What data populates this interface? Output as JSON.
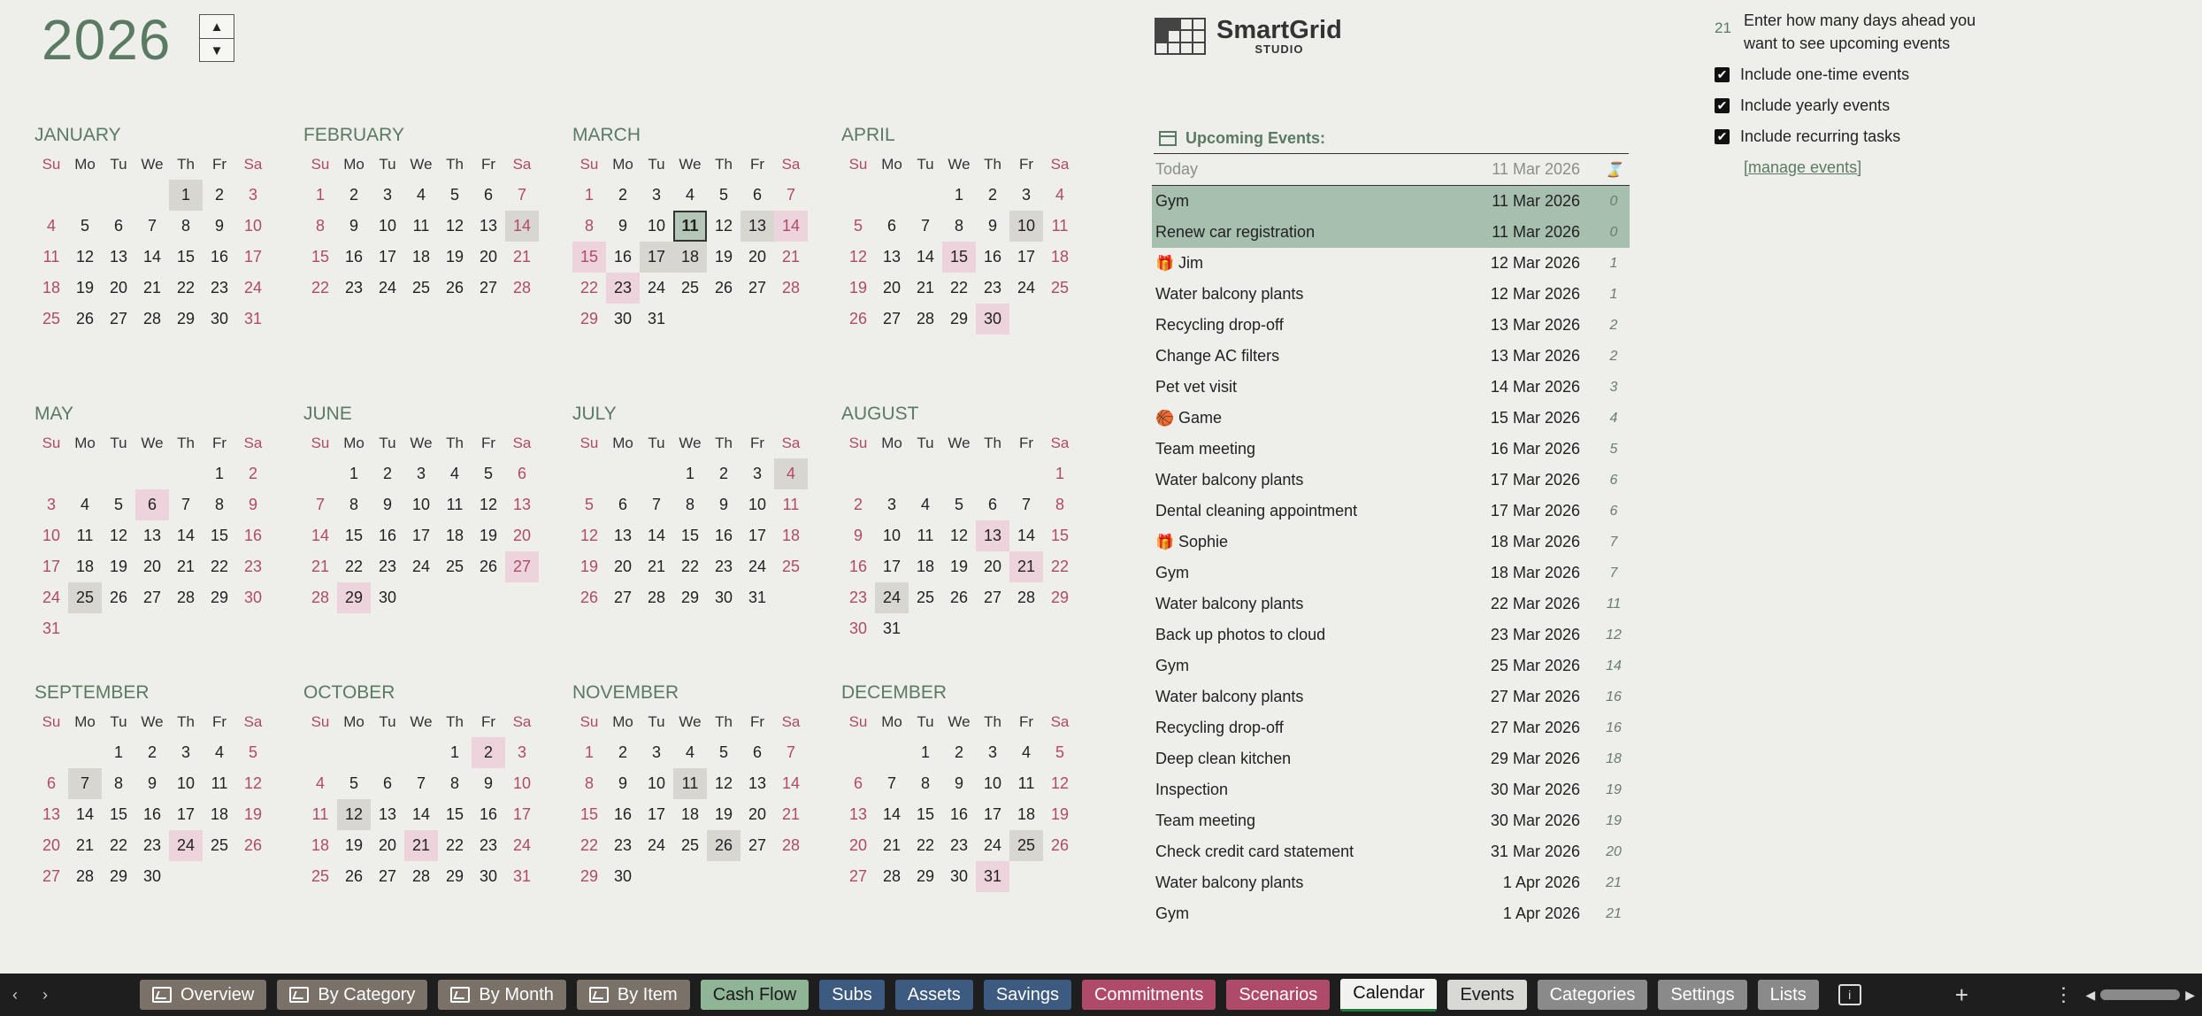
{
  "year": "2026",
  "spinner": {
    "up": "▲",
    "down": "▼"
  },
  "dow": [
    "Su",
    "Mo",
    "Tu",
    "We",
    "Th",
    "Fr",
    "Sa"
  ],
  "months": [
    {
      "name": "JANUARY",
      "start": 4,
      "days": 31,
      "gray": [
        1
      ],
      "pink": []
    },
    {
      "name": "FEBRUARY",
      "start": 0,
      "days": 28,
      "gray": [
        14
      ],
      "pink": []
    },
    {
      "name": "MARCH",
      "start": 0,
      "days": 31,
      "gray": [
        13,
        17,
        18
      ],
      "pink": [
        14,
        15,
        23
      ],
      "today": 11
    },
    {
      "name": "APRIL",
      "start": 3,
      "days": 30,
      "gray": [
        10
      ],
      "pink": [
        15,
        30
      ]
    },
    {
      "name": "MAY",
      "start": 5,
      "days": 31,
      "gray": [
        25
      ],
      "pink": [
        6
      ]
    },
    {
      "name": "JUNE",
      "start": 1,
      "days": 30,
      "gray": [],
      "pink": [
        27,
        29
      ]
    },
    {
      "name": "JULY",
      "start": 3,
      "days": 31,
      "gray": [
        4
      ],
      "pink": []
    },
    {
      "name": "AUGUST",
      "start": 6,
      "days": 31,
      "gray": [
        24
      ],
      "pink": [
        13,
        21
      ]
    },
    {
      "name": "SEPTEMBER",
      "start": 2,
      "days": 30,
      "gray": [
        7
      ],
      "pink": [
        24
      ]
    },
    {
      "name": "OCTOBER",
      "start": 4,
      "days": 31,
      "gray": [
        12
      ],
      "pink": [
        2,
        21
      ]
    },
    {
      "name": "NOVEMBER",
      "start": 0,
      "days": 30,
      "gray": [
        11,
        26
      ],
      "pink": []
    },
    {
      "name": "DECEMBER",
      "start": 2,
      "days": 31,
      "gray": [
        25
      ],
      "pink": [
        31
      ]
    }
  ],
  "logo": {
    "name": "SmartGrid",
    "sub": "STUDIO"
  },
  "settings": {
    "days_ahead": "21",
    "days_desc": "Enter how many days ahead you want to see upcoming events",
    "opt1": "Include one-time events",
    "opt2": "Include yearly events",
    "opt3": "Include recurring tasks",
    "check": "✔",
    "manage": "[manage events]"
  },
  "events": {
    "title": "Upcoming Events:",
    "today_label": "Today",
    "today_date": "11 Mar 2026",
    "hourglass": "⌛",
    "rows": [
      {
        "name": "Gym",
        "date": "11 Mar 2026",
        "days": "0",
        "now": true
      },
      {
        "name": "Renew car registration",
        "date": "11 Mar 2026",
        "days": "0",
        "now": true
      },
      {
        "name": "Jim",
        "date": "12 Mar 2026",
        "days": "1",
        "icon": "gift-icon"
      },
      {
        "name": "Water balcony plants",
        "date": "12 Mar 2026",
        "days": "1"
      },
      {
        "name": "Recycling drop-off",
        "date": "13 Mar 2026",
        "days": "2"
      },
      {
        "name": "Change AC filters",
        "date": "13 Mar 2026",
        "days": "2"
      },
      {
        "name": "Pet vet visit",
        "date": "14 Mar 2026",
        "days": "3"
      },
      {
        "name": "Game",
        "date": "15 Mar 2026",
        "days": "4",
        "icon": "basketball-icon"
      },
      {
        "name": "Team meeting",
        "date": "16 Mar 2026",
        "days": "5"
      },
      {
        "name": "Water balcony plants",
        "date": "17 Mar 2026",
        "days": "6"
      },
      {
        "name": "Dental cleaning appointment",
        "date": "17 Mar 2026",
        "days": "6"
      },
      {
        "name": "Sophie",
        "date": "18 Mar 2026",
        "days": "7",
        "icon": "gift-icon"
      },
      {
        "name": "Gym",
        "date": "18 Mar 2026",
        "days": "7"
      },
      {
        "name": "Water balcony plants",
        "date": "22 Mar 2026",
        "days": "11"
      },
      {
        "name": "Back up photos to cloud",
        "date": "23 Mar 2026",
        "days": "12"
      },
      {
        "name": "Gym",
        "date": "25 Mar 2026",
        "days": "14"
      },
      {
        "name": "Water balcony plants",
        "date": "27 Mar 2026",
        "days": "16"
      },
      {
        "name": "Recycling drop-off",
        "date": "27 Mar 2026",
        "days": "16"
      },
      {
        "name": "Deep clean kitchen",
        "date": "29 Mar 2026",
        "days": "18"
      },
      {
        "name": "Inspection",
        "date": "30 Mar 2026",
        "days": "19"
      },
      {
        "name": "Team meeting",
        "date": "30 Mar 2026",
        "days": "19"
      },
      {
        "name": "Check credit card statement",
        "date": "31 Mar 2026",
        "days": "20"
      },
      {
        "name": "Water balcony plants",
        "date": "1 Apr 2026",
        "days": "21"
      },
      {
        "name": "Gym",
        "date": "1 Apr 2026",
        "days": "21"
      }
    ]
  },
  "icons": {
    "gift-icon": "🎁",
    "basketball-icon": "🏀"
  },
  "tabbar": {
    "prev": "‹",
    "next": "›",
    "plus": "+",
    "more": "⋮",
    "info": "i",
    "scroll_left": "◀",
    "scroll_right": "▶",
    "tabs": [
      {
        "label": "Overview",
        "color": "#7a7268",
        "icon": true
      },
      {
        "label": "By Category",
        "color": "#7a7268",
        "icon": true
      },
      {
        "label": "By Month",
        "color": "#7a7268",
        "icon": true
      },
      {
        "label": "By Item",
        "color": "#7a7268",
        "icon": true
      },
      {
        "label": "Cash Flow",
        "color": "#8fb596",
        "dark": true
      },
      {
        "label": "Subs",
        "color": "#3d5a80"
      },
      {
        "label": "Assets",
        "color": "#3d5a80"
      },
      {
        "label": "Savings",
        "color": "#3d5a80"
      },
      {
        "label": "Commitments",
        "color": "#b04a6a"
      },
      {
        "label": "Scenarios",
        "color": "#b04a6a"
      },
      {
        "label": "Calendar",
        "active": true
      },
      {
        "label": "Events",
        "color": "#d8d8d4",
        "dark": true
      },
      {
        "label": "Categories",
        "color": "#8a8a8a"
      },
      {
        "label": "Settings",
        "color": "#8a8a8a"
      },
      {
        "label": "Lists",
        "color": "#8a8a8a"
      }
    ]
  }
}
